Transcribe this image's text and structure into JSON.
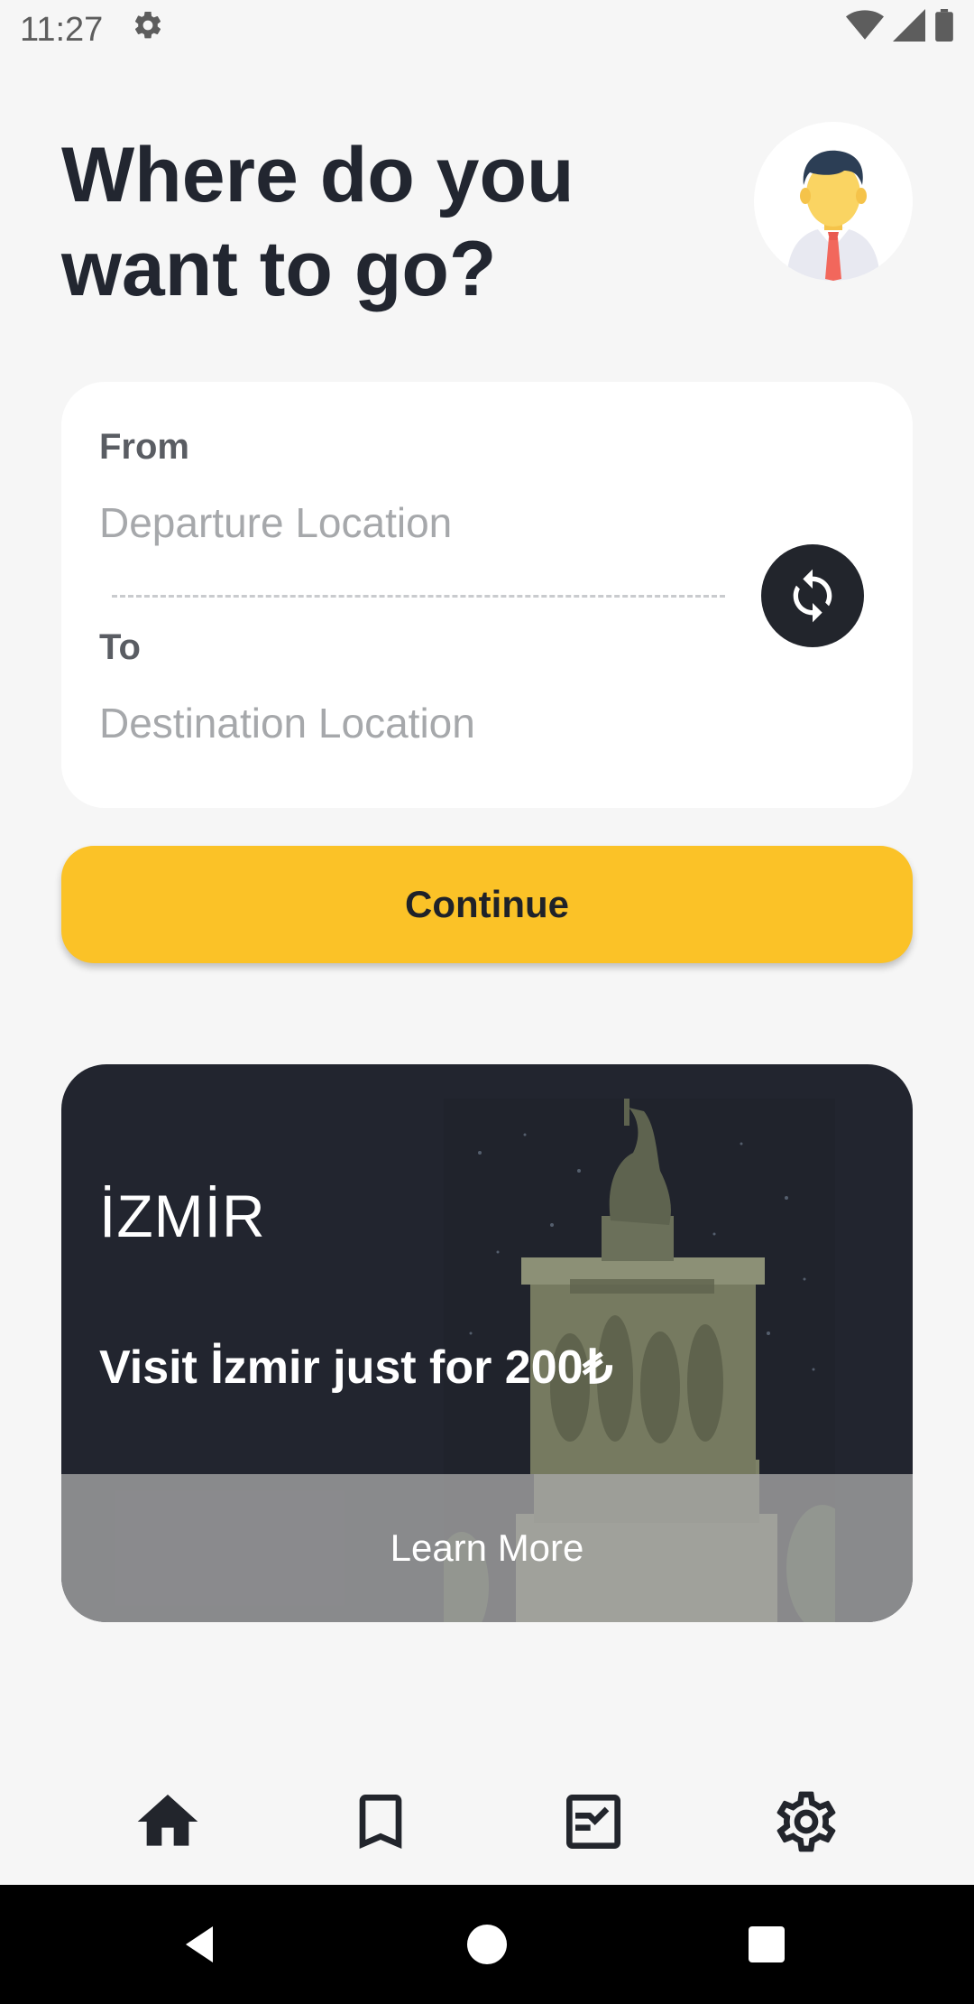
{
  "status_bar": {
    "time": "11:27",
    "icons": [
      "settings-icon",
      "wifi-icon",
      "signal-icon",
      "battery-icon"
    ]
  },
  "header": {
    "title": "Where do you\nwant to go?",
    "avatar_icon": "user-avatar"
  },
  "route": {
    "from_label": "From",
    "from_placeholder": "Departure Location",
    "from_value": "",
    "to_label": "To",
    "to_placeholder": "Destination Location",
    "to_value": "",
    "swap_icon": "swap-icon"
  },
  "continue_label": "Continue",
  "promo": {
    "city": "İZMİR",
    "text": "Visit İzmir just for 200₺",
    "button_label": "Learn More"
  },
  "bottom_nav": {
    "items": [
      {
        "icon": "home-icon"
      },
      {
        "icon": "bookmark-icon"
      },
      {
        "icon": "checklist-icon"
      },
      {
        "icon": "gear-icon"
      }
    ]
  },
  "colors": {
    "accent": "#fbc227",
    "dark": "#22252c",
    "background": "#f6f6f6"
  }
}
